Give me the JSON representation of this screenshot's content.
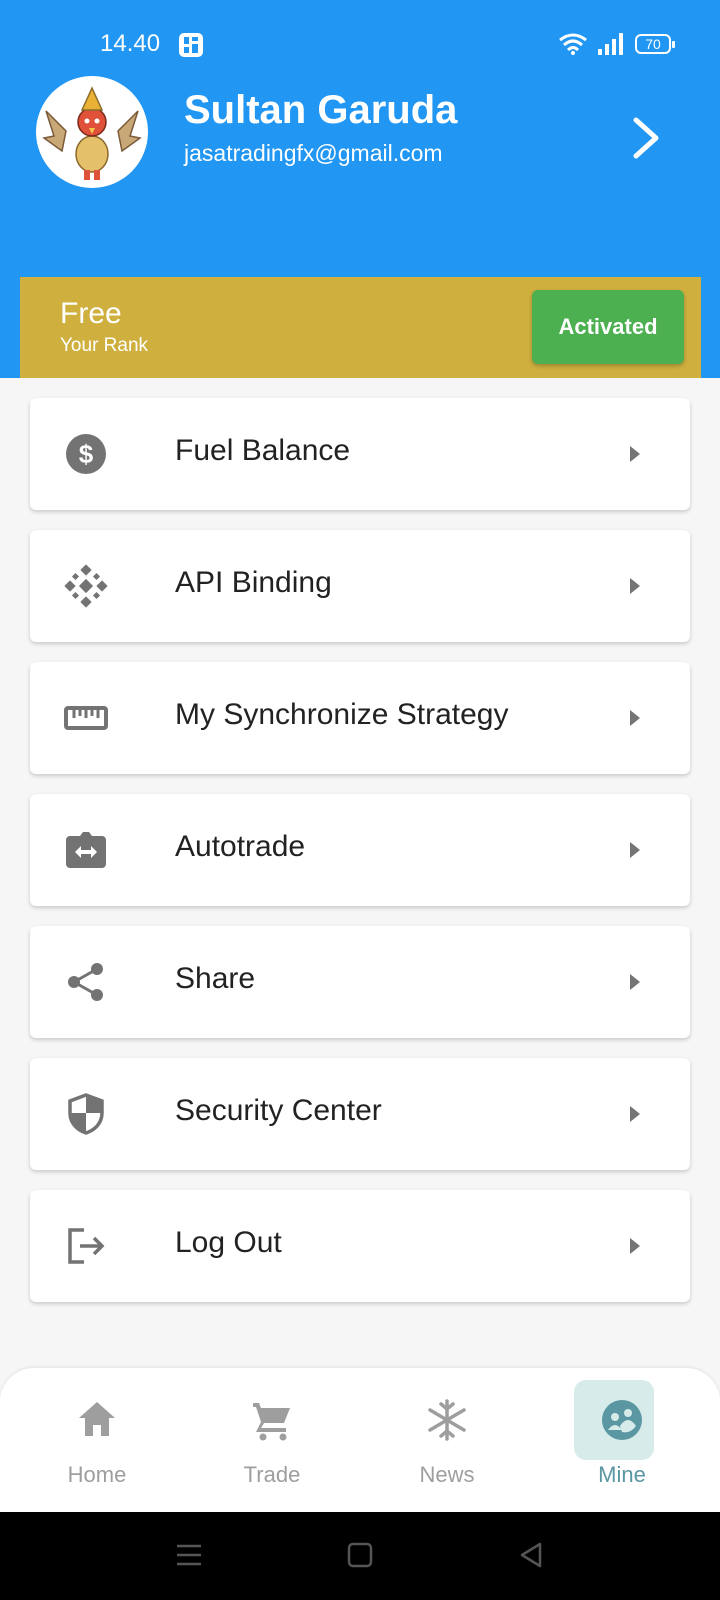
{
  "status_bar": {
    "time": "14.40",
    "battery": "70"
  },
  "profile": {
    "name": "Sultan Garuda",
    "email": "jasatradingfx@gmail.com"
  },
  "rank": {
    "name": "Free",
    "label": "Your Rank",
    "button": "Activated"
  },
  "menu": [
    {
      "label": "Fuel Balance",
      "icon": "dollar-icon"
    },
    {
      "label": "API Binding",
      "icon": "binance-icon"
    },
    {
      "label": "My Synchronize Strategy",
      "icon": "ruler-icon"
    },
    {
      "label": "Autotrade",
      "icon": "swap-icon"
    },
    {
      "label": "Share",
      "icon": "share-icon"
    },
    {
      "label": "Security Center",
      "icon": "shield-icon"
    },
    {
      "label": "Log Out",
      "icon": "logout-icon"
    }
  ],
  "bottom_nav": [
    {
      "label": "Home",
      "icon": "home-icon"
    },
    {
      "label": "Trade",
      "icon": "cart-icon"
    },
    {
      "label": "News",
      "icon": "snowflake-icon"
    },
    {
      "label": "Mine",
      "icon": "mine-icon",
      "active": true
    }
  ],
  "colors": {
    "header": "#2196F3",
    "rank": "#CFB03F",
    "activated": "#4CAF50",
    "active_nav": "#5a97a2"
  }
}
